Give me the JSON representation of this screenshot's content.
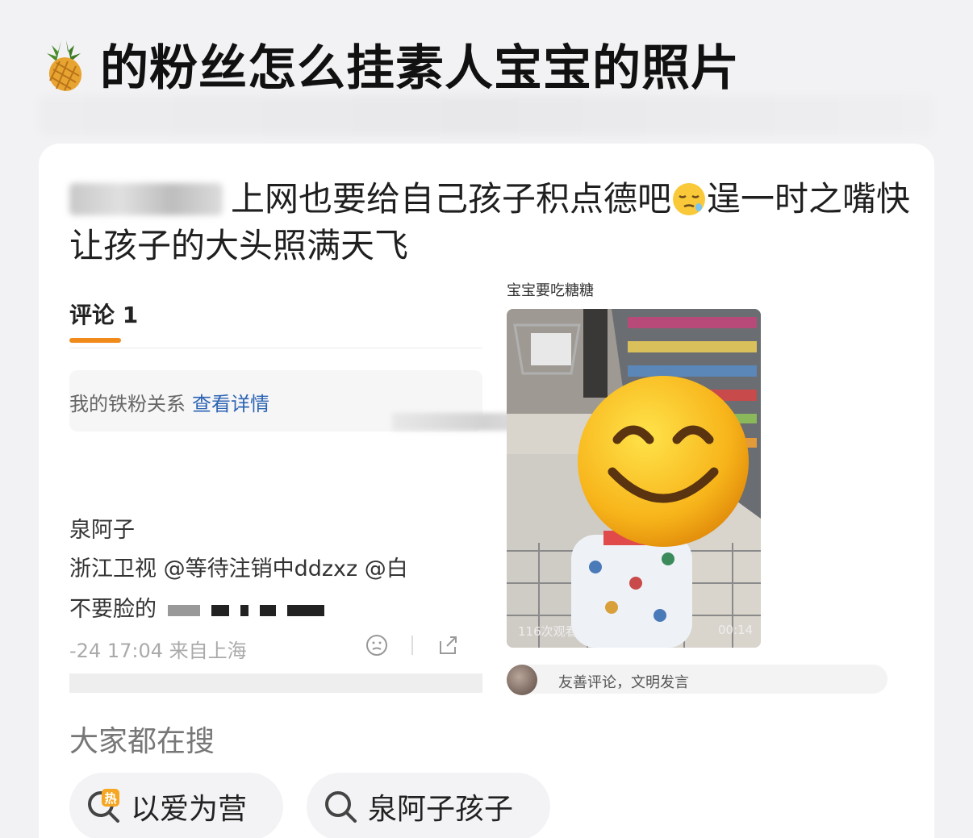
{
  "header": {
    "title": "的粉丝怎么挂素人宝宝的照片",
    "icon": "pineapple-emoji"
  },
  "post": {
    "text_1": "上网也要给自己孩子积点德吧",
    "text_2": "逞一时之嘴快让孩子的大头照满天飞"
  },
  "left_screenshot": {
    "comments_heading": "评论 1",
    "fan_text": "我的铁粉关系",
    "fan_link": "查看详情",
    "user_name": "泉阿子",
    "mention_line": "浙江卫视 @等待注销中ddzxz @白",
    "blurred_line": "不要脸的",
    "meta": "-24 17:04 来自上海"
  },
  "right_screenshot": {
    "caption": "宝宝要吃糖糖",
    "views": "116次观看",
    "duration": "00:14",
    "comment_hint": "友善评论，文明发言"
  },
  "search": {
    "heading": "大家都在搜",
    "chips": [
      {
        "label": "以爱为营",
        "icon": "hot-search-icon"
      },
      {
        "label": "泉阿子孩子",
        "icon": "search-icon"
      }
    ]
  },
  "colors": {
    "accent": "#f08a1a",
    "link": "#2d64b3",
    "background": "#f2f2f4"
  }
}
